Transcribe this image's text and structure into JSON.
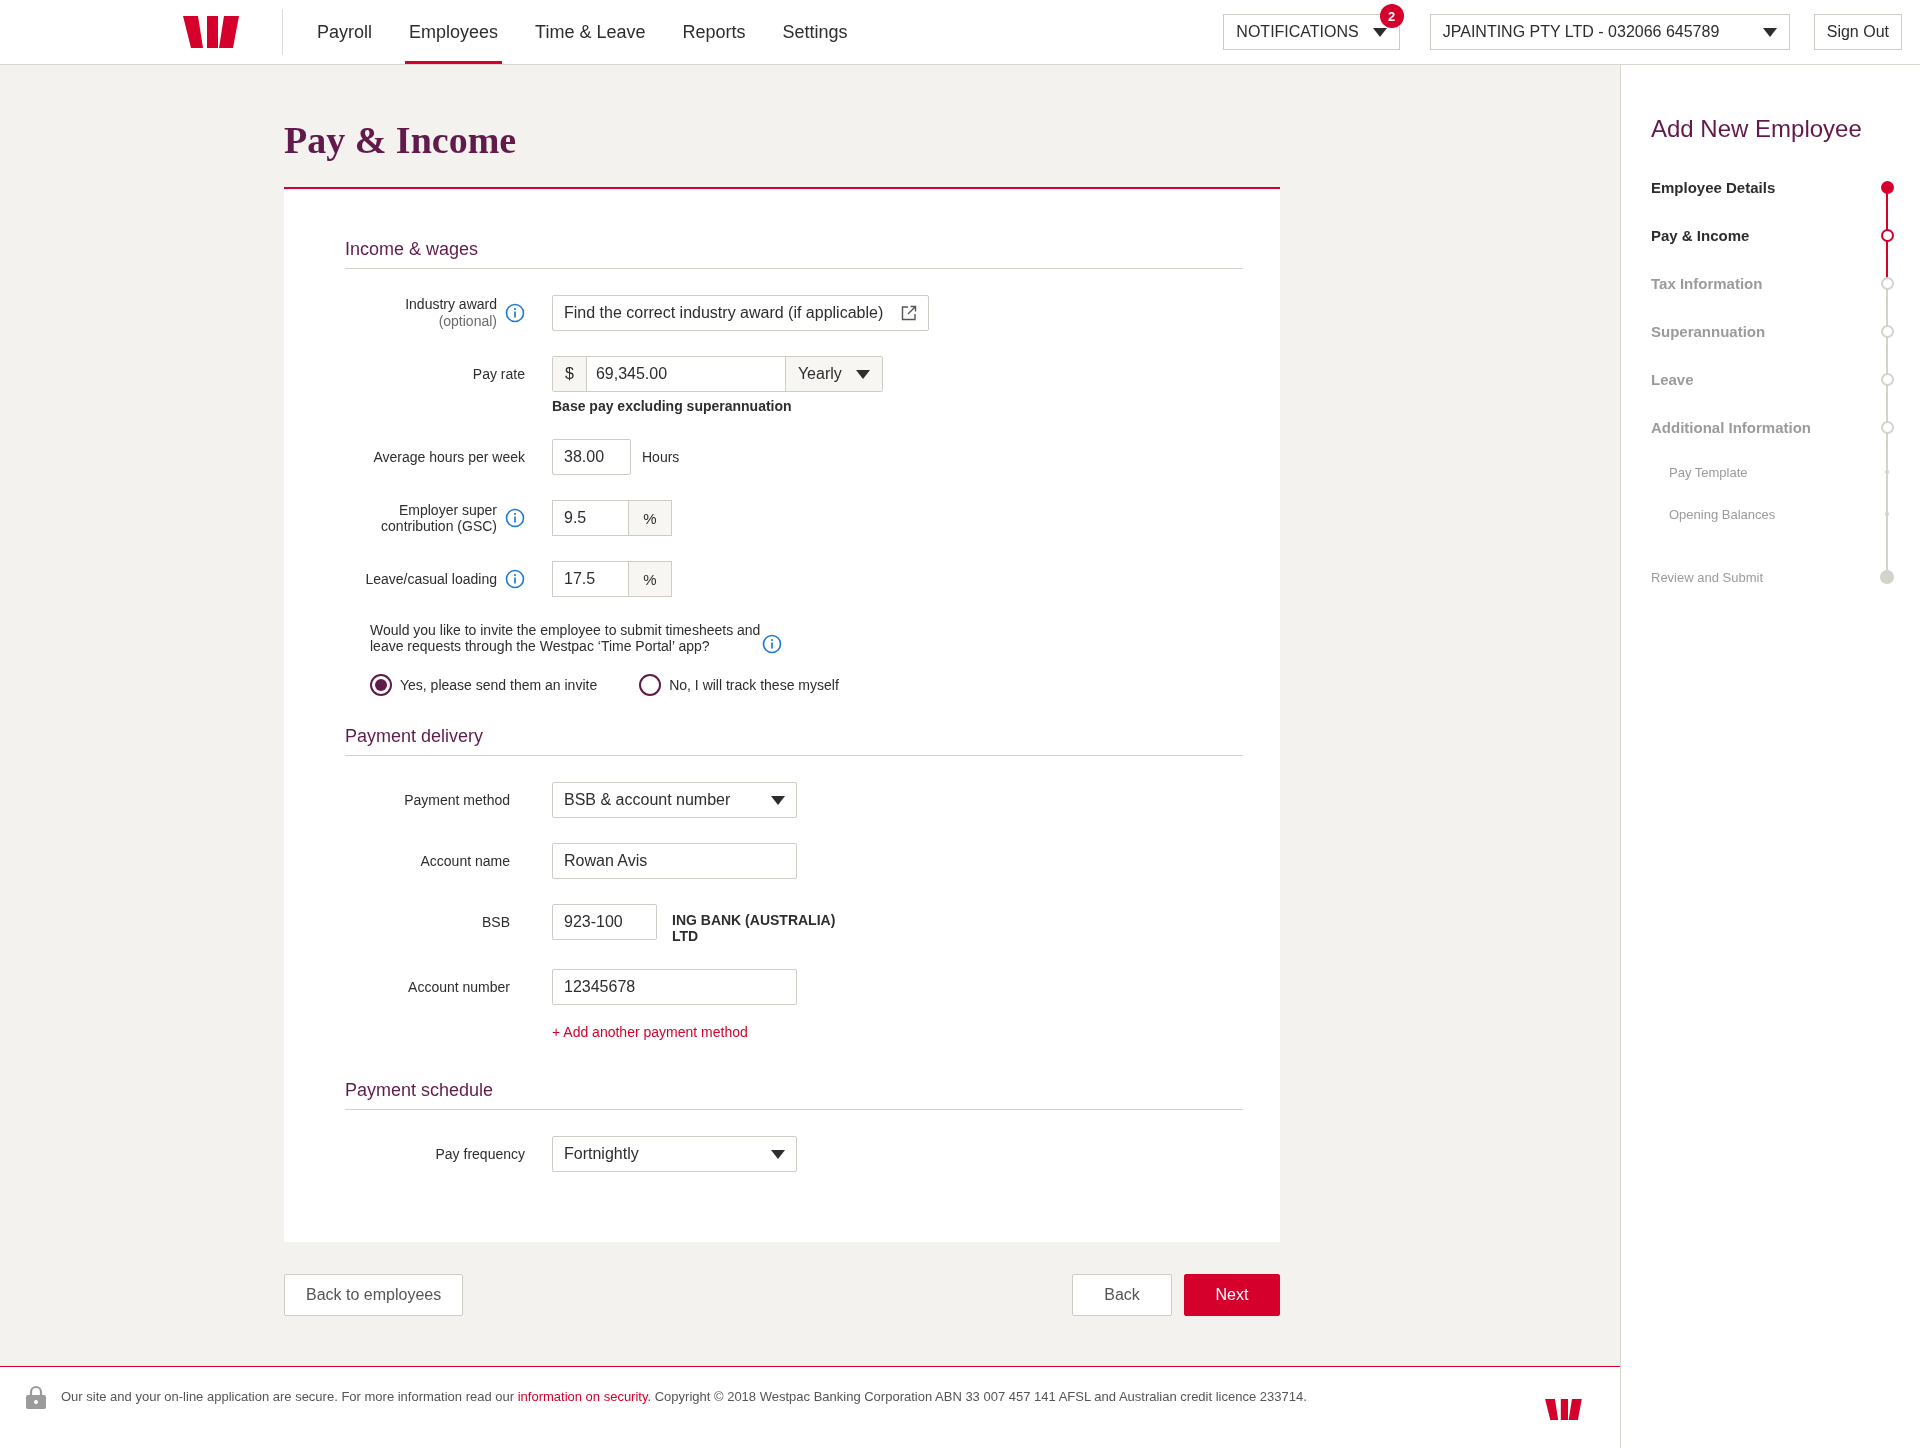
{
  "nav": [
    {
      "label": "Payroll",
      "selected": false
    },
    {
      "label": "Employees",
      "selected": true
    },
    {
      "label": "Time & Leave",
      "selected": false
    },
    {
      "label": "Reports",
      "selected": false
    },
    {
      "label": "Settings",
      "selected": false
    }
  ],
  "notifications": {
    "label": "NOTIFICATIONS",
    "count": "2"
  },
  "company": "JPAINTING PTY LTD - 032066 645789",
  "sign_out": "Sign Out",
  "page_title": "Pay & Income",
  "sections": [
    {
      "title": "Income & wages",
      "rows": [
        {
          "kind": "link",
          "label": "Industry award",
          "sublabel": "(optional)",
          "info": true,
          "value": "Find the correct industry award (if applicable)"
        },
        {
          "kind": "money",
          "label": "Pay rate",
          "prefix": "$",
          "value": "69,345.00",
          "period": "Yearly",
          "hint": "Base pay excluding superannuation"
        },
        {
          "kind": "unit",
          "label": "Average hours per week",
          "value": "38.00",
          "unit": "Hours"
        },
        {
          "kind": "percent",
          "label": "Employer super contribution (GSC)",
          "info": true,
          "value": "9.5",
          "unit": "%"
        },
        {
          "kind": "percent",
          "label": "Leave/casual loading",
          "info": true,
          "value": "17.5",
          "unit": "%"
        },
        {
          "kind": "question",
          "text": "Would you like to invite the employee to submit timesheets and leave requests through the Westpac ‘Time Portal’ app?",
          "info": true,
          "options": [
            {
              "label": "Yes, please send them an invite",
              "selected": true
            },
            {
              "label": "No, I will track these myself",
              "selected": false
            }
          ]
        }
      ]
    },
    {
      "title": "Payment delivery",
      "rows": [
        {
          "kind": "select",
          "label": "Payment method",
          "value": "BSB & account number"
        },
        {
          "kind": "text",
          "label": "Account name",
          "value": "Rowan Avis"
        },
        {
          "kind": "bsb",
          "label": "BSB",
          "value": "923-100",
          "bank": "ING BANK (AUSTRALIA) LTD"
        },
        {
          "kind": "text",
          "label": "Account number",
          "value": "12345678"
        },
        {
          "kind": "add",
          "text": "+ Add another payment method"
        }
      ]
    },
    {
      "title": "Payment schedule",
      "rows": [
        {
          "kind": "select",
          "label": "Pay frequency",
          "value": "Fortnightly"
        }
      ]
    }
  ],
  "buttons": {
    "back_to_employees": "Back to employees",
    "back": "Back",
    "next": "Next"
  },
  "sidebar": {
    "title": "Add New Employee",
    "steps": [
      {
        "kind": "step",
        "label": "Employee Details",
        "completed": true,
        "current": false
      },
      {
        "kind": "step",
        "label": "Pay & Income",
        "completed": false,
        "current": true
      },
      {
        "kind": "step",
        "label": "Tax Information",
        "completed": false,
        "current": false
      },
      {
        "kind": "step",
        "label": "Superannuation",
        "completed": false,
        "current": false
      },
      {
        "kind": "step",
        "label": "Leave",
        "completed": false,
        "current": false
      },
      {
        "kind": "step",
        "label": "Additional Information",
        "completed": false,
        "current": false
      },
      {
        "kind": "substep",
        "label": "Pay Template"
      },
      {
        "kind": "substep",
        "label": "Opening Balances"
      },
      {
        "kind": "final",
        "label": "Review and Submit"
      }
    ]
  },
  "footer": {
    "text_before": "Our site and your on-line application are secure. For more information read our ",
    "link": "information on security.",
    "text_after": " Copyright © 2018 Westpac Banking Corporation ABN 33 007 457 141 AFSL and Australian credit licence 233714."
  }
}
